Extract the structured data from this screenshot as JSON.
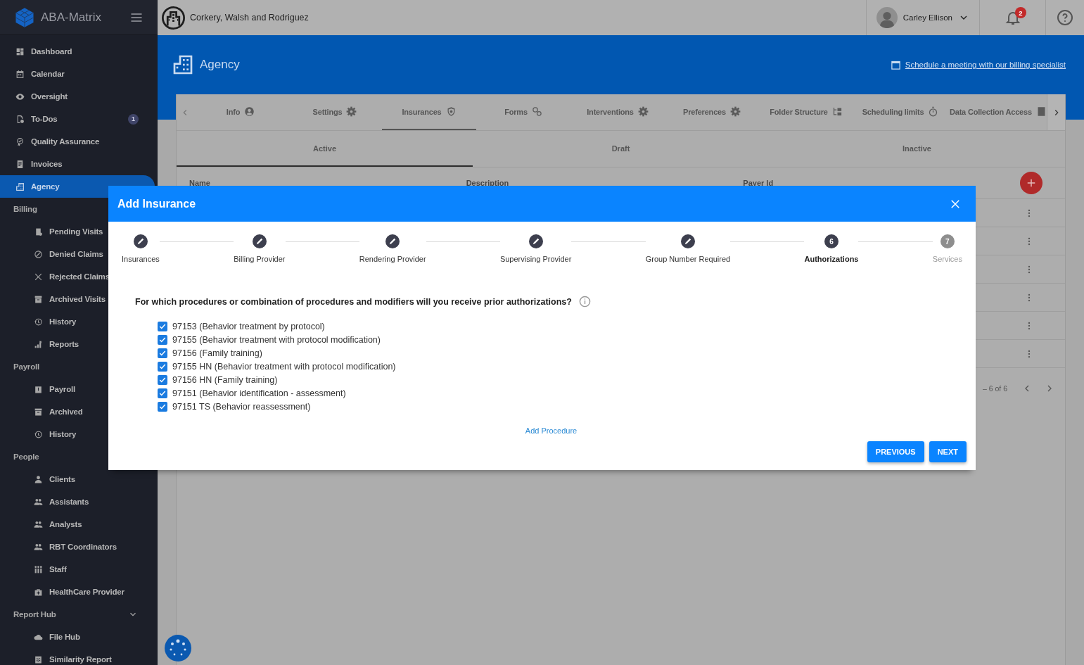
{
  "brand": {
    "name": "ABA-Matrix"
  },
  "topbar": {
    "company": "Corkery, Walsh and Rodriguez",
    "user": "Carley Ellison",
    "notifications": "2"
  },
  "sidebar": {
    "items": [
      {
        "label": "Dashboard",
        "selected": false
      },
      {
        "label": "Calendar",
        "selected": false
      },
      {
        "label": "Oversight",
        "selected": false
      },
      {
        "label": "To-Dos",
        "selected": false,
        "badge": "1"
      },
      {
        "label": "Quality Assurance",
        "selected": false
      },
      {
        "label": "Invoices",
        "selected": false
      },
      {
        "label": "Agency",
        "selected": true
      }
    ],
    "sections": [
      {
        "title": "Billing",
        "items": [
          {
            "label": "Pending Visits",
            "selected": false
          },
          {
            "label": "Denied Claims",
            "selected": false
          },
          {
            "label": "Rejected Claims",
            "selected": false
          },
          {
            "label": "Archived Visits",
            "selected": false
          },
          {
            "label": "History",
            "selected": false
          },
          {
            "label": "Reports",
            "selected": false
          }
        ]
      },
      {
        "title": "Payroll",
        "items": [
          {
            "label": "Payroll",
            "selected": false
          },
          {
            "label": "Archived",
            "selected": false
          },
          {
            "label": "History",
            "selected": false
          }
        ]
      },
      {
        "title": "People",
        "items": [
          {
            "label": "Clients",
            "selected": false
          },
          {
            "label": "Assistants",
            "selected": false
          },
          {
            "label": "Analysts",
            "selected": false
          },
          {
            "label": "RBT Coordinators",
            "selected": false
          },
          {
            "label": "Staff",
            "selected": false
          },
          {
            "label": "HealthCare Provider",
            "selected": false
          }
        ]
      },
      {
        "title": "Report Hub",
        "expanded": true,
        "items": [
          {
            "label": "File Hub",
            "selected": false
          },
          {
            "label": "Similarity Report",
            "selected": false
          }
        ]
      }
    ]
  },
  "page": {
    "title": "Agency",
    "link": "Schedule a meeting with our billing specialist",
    "tabs": [
      {
        "label": "Info",
        "selected": false
      },
      {
        "label": "Settings",
        "selected": false
      },
      {
        "label": "Insurances",
        "selected": true
      },
      {
        "label": "Forms",
        "selected": false
      },
      {
        "label": "Interventions",
        "selected": false
      },
      {
        "label": "Preferences",
        "selected": false
      },
      {
        "label": "Folder Structure",
        "selected": false
      },
      {
        "label": "Scheduling limits",
        "selected": false
      },
      {
        "label": "Data Collection Access",
        "selected": false
      }
    ],
    "subtabs": [
      {
        "label": "Active",
        "selected": true
      },
      {
        "label": "Draft",
        "selected": false
      },
      {
        "label": "Inactive",
        "selected": false
      }
    ],
    "table": {
      "columns": [
        "Name",
        "Description",
        "Payer Id"
      ],
      "rows": [
        {
          "actions_menu": true
        },
        {
          "actions_menu": true
        },
        {
          "actions_menu": true
        },
        {
          "actions_menu": true
        },
        {
          "actions_menu": true
        },
        {
          "actions_menu": true
        }
      ],
      "pagination": "– 6 of 6"
    }
  },
  "modal": {
    "title": "Add Insurance",
    "steps": [
      {
        "label": "Insurances",
        "completed": true,
        "active": false
      },
      {
        "label": "Billing Provider",
        "completed": true,
        "active": false
      },
      {
        "label": "Rendering Provider",
        "completed": true,
        "active": false
      },
      {
        "label": "Supervising Provider",
        "completed": true,
        "active": false
      },
      {
        "label": "Group Number Required",
        "completed": true,
        "active": false
      },
      {
        "label": "Authorizations",
        "completed": false,
        "active": true,
        "number": "6"
      },
      {
        "label": "Services",
        "completed": false,
        "active": false,
        "number": "7"
      }
    ],
    "question": "For which procedures or combination of procedures and modifiers will you receive prior authorizations?",
    "procedures": [
      {
        "label": "97153 (Behavior treatment by protocol)",
        "checked": true
      },
      {
        "label": "97155 (Behavior treatment with protocol modification)",
        "checked": true
      },
      {
        "label": "97156 (Family training)",
        "checked": true
      },
      {
        "label": "97155 HN (Behavior treatment with protocol modification)",
        "checked": true
      },
      {
        "label": "97156 HN (Family training)",
        "checked": true
      },
      {
        "label": "97151 (Behavior identification - assessment)",
        "checked": true
      },
      {
        "label": "97151 TS (Behavior reassessment)",
        "checked": true
      }
    ],
    "add_link": "Add Procedure",
    "buttons": [
      "PREVIOUS",
      "NEXT"
    ]
  }
}
